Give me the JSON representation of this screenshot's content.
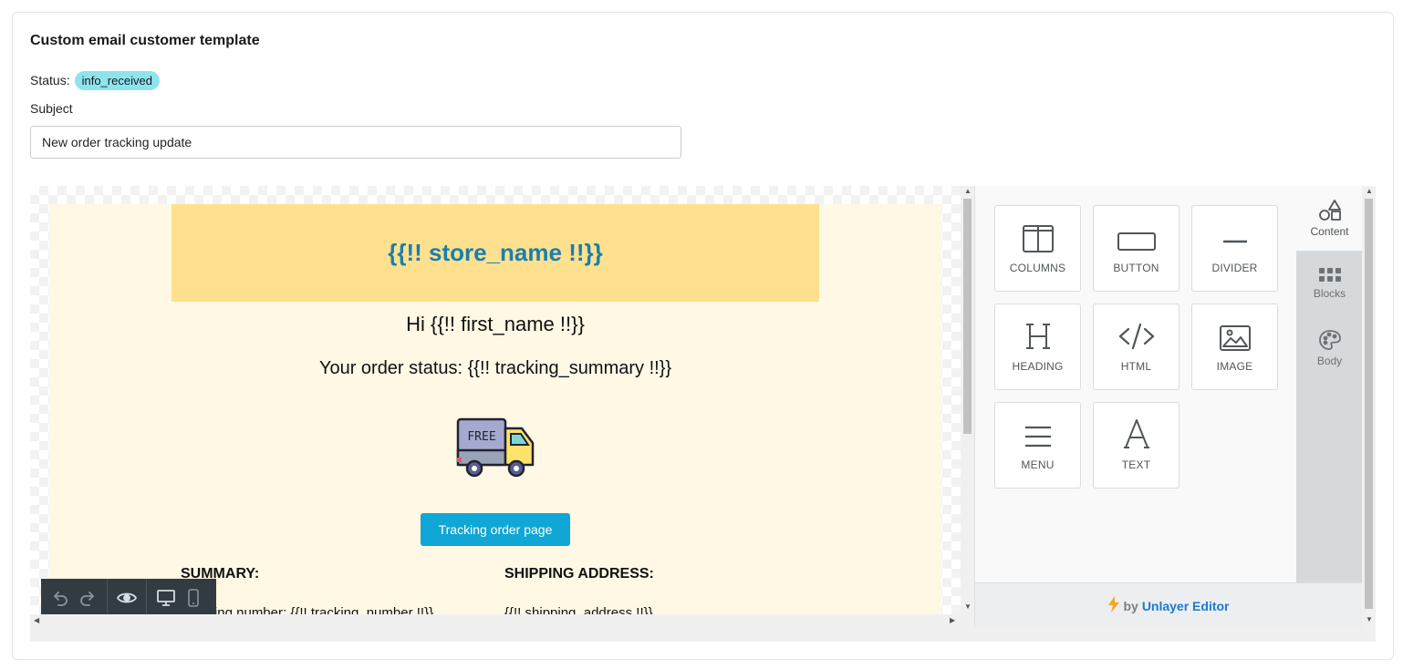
{
  "card": {
    "title": "Custom email customer template",
    "status_label": "Status:",
    "status_value": "info_received",
    "subject_label": "Subject",
    "subject_value": "New order tracking update"
  },
  "email": {
    "store_name": "{{!! store_name !!}}",
    "greeting": "Hi {{!! first_name !!}}",
    "status_line": "Your order status: {{!! tracking_summary !!}}",
    "truck_label": "FREE",
    "button_label": "Tracking order page",
    "summary_title": "SUMMARY:",
    "summary_text": "Tracking number: {{!! tracking_number !!}}",
    "shipping_title": "SHIPPING ADDRESS:",
    "shipping_text": "{{!! shipping_address !!}}",
    "colors": {
      "body_bg": "#fef8e4",
      "header_bg": "#fee08f",
      "store_name": "#1a7fad",
      "button_bg": "#10a6d6"
    }
  },
  "toolbar": {
    "icons": [
      "undo-icon",
      "redo-icon",
      "eye-icon",
      "desktop-icon",
      "mobile-icon"
    ]
  },
  "tools": [
    {
      "label": "COLUMNS",
      "icon": "columns-icon"
    },
    {
      "label": "BUTTON",
      "icon": "button-icon"
    },
    {
      "label": "DIVIDER",
      "icon": "divider-icon"
    },
    {
      "label": "HEADING",
      "icon": "heading-icon"
    },
    {
      "label": "HTML",
      "icon": "code-icon"
    },
    {
      "label": "IMAGE",
      "icon": "image-icon"
    },
    {
      "label": "MENU",
      "icon": "menu-icon"
    },
    {
      "label": "TEXT",
      "icon": "text-icon"
    }
  ],
  "tabs": [
    {
      "label": "Content",
      "icon": "shapes-icon",
      "active": true
    },
    {
      "label": "Blocks",
      "icon": "grid-icon",
      "active": false
    },
    {
      "label": "Body",
      "icon": "palette-icon",
      "active": false
    }
  ],
  "footer": {
    "by": "by",
    "brand": "Unlayer Editor"
  }
}
